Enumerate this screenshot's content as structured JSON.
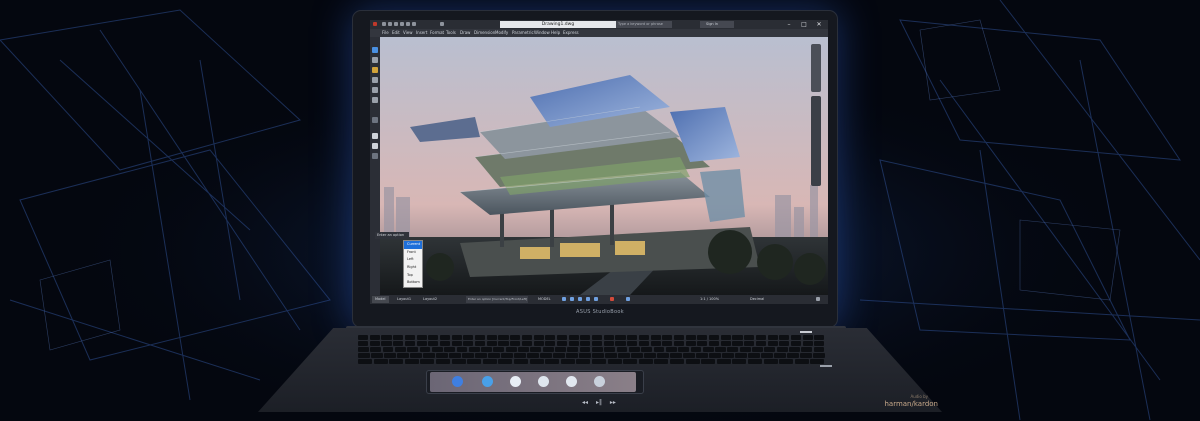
{
  "laptop": {
    "brand": "ASUS StudioBook",
    "speaker_brand": "harman/kardon",
    "speaker_tag": "Audio by",
    "media_keys": [
      "◂◂",
      "▸‖",
      "▸▸"
    ],
    "touchpad_icon_colors": [
      "#3f7fe0",
      "#49a0e8",
      "#e8eef6",
      "#dfe6ee",
      "#e2e8f0",
      "#c9d1dc"
    ]
  },
  "app": {
    "document_title": "Drawing1.dwg",
    "search_placeholder": "Type a keyword or phrase",
    "sign_in": "Sign In",
    "menu": [
      "File",
      "Edit",
      "View",
      "Insert",
      "Format",
      "Tools",
      "Draw",
      "Dimension",
      "Modify",
      "Parametric",
      "Window",
      "Help",
      "Express"
    ],
    "window_buttons": [
      "–",
      "□",
      "✕"
    ],
    "layout_tabs": [
      "Model",
      "Layout1",
      "Layout2"
    ],
    "command_line": "Enter an option [Current/Top/Front/Left]",
    "status_text": [
      "MODEL",
      "1:1 / 100%",
      "Decimal"
    ],
    "popup": {
      "title": "Enter an option",
      "items": [
        "Current",
        "Front",
        "Left",
        "Right",
        "Top",
        "Bottom",
        "Back"
      ],
      "selected": "Current"
    }
  },
  "colors": {
    "accent": "#1e6fd9",
    "glow": "#3c78ff",
    "sky_top": "#b9bfd0",
    "sky_bottom": "#d8b7b5"
  }
}
